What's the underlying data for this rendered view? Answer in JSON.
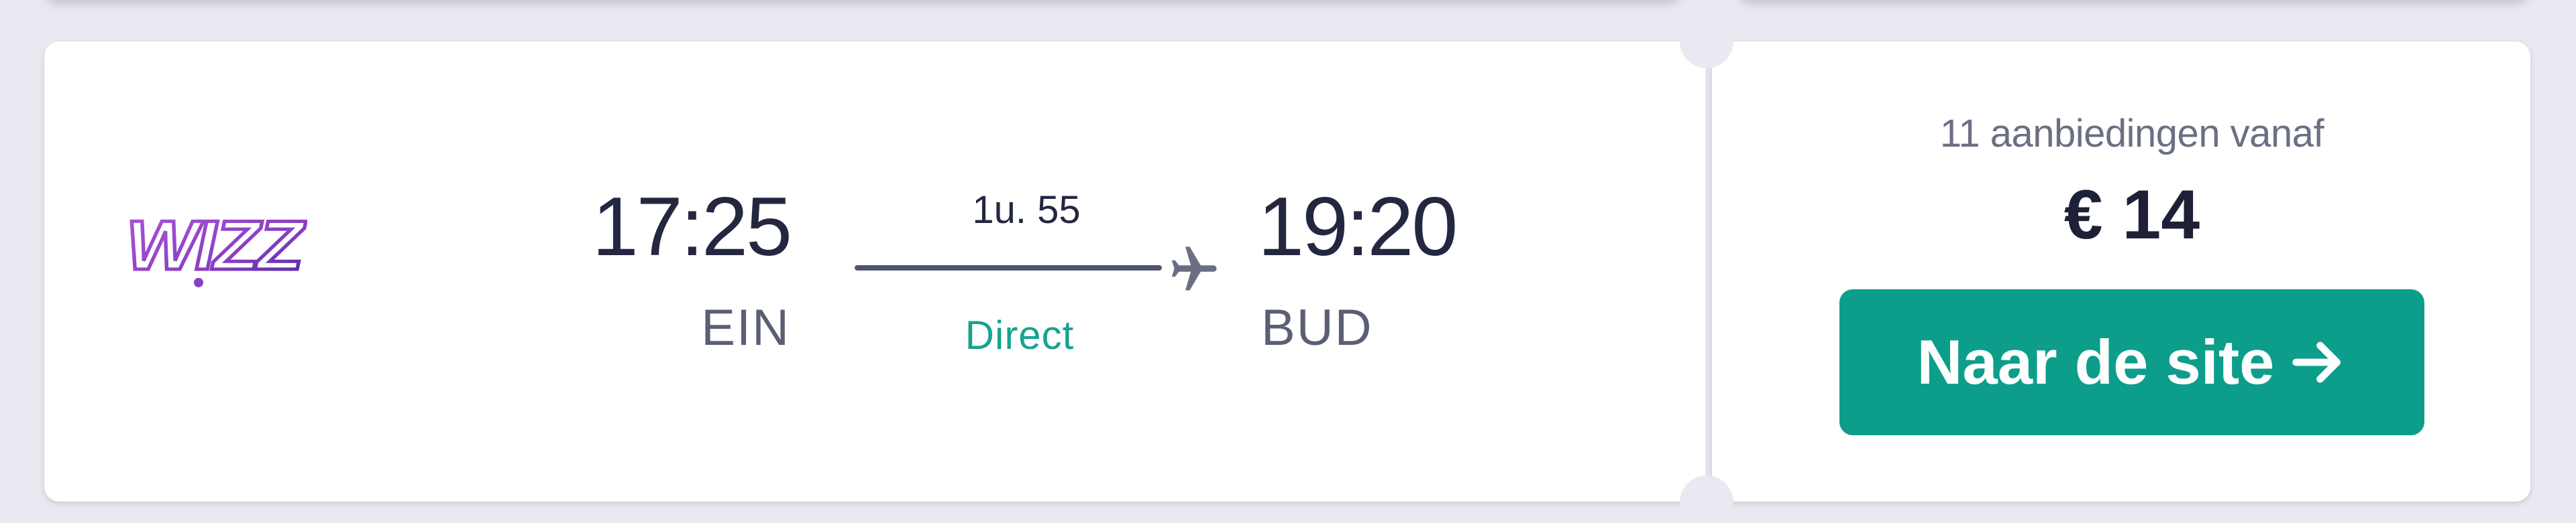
{
  "flight": {
    "airline": "Wizz Air",
    "airline_logo_text": "WIZZ",
    "departure_time": "17:25",
    "departure_code": "EIN",
    "arrival_time": "19:20",
    "arrival_code": "BUD",
    "duration": "1u. 55",
    "stops": "Direct"
  },
  "offer": {
    "count_label": "11 aanbiedingen vanaf",
    "price": "€ 14",
    "cta_label": "Naar de site"
  },
  "colors": {
    "accent": "#0c9e8b",
    "direct": "#16a38f",
    "logo_purple": "#8a3fc4"
  }
}
